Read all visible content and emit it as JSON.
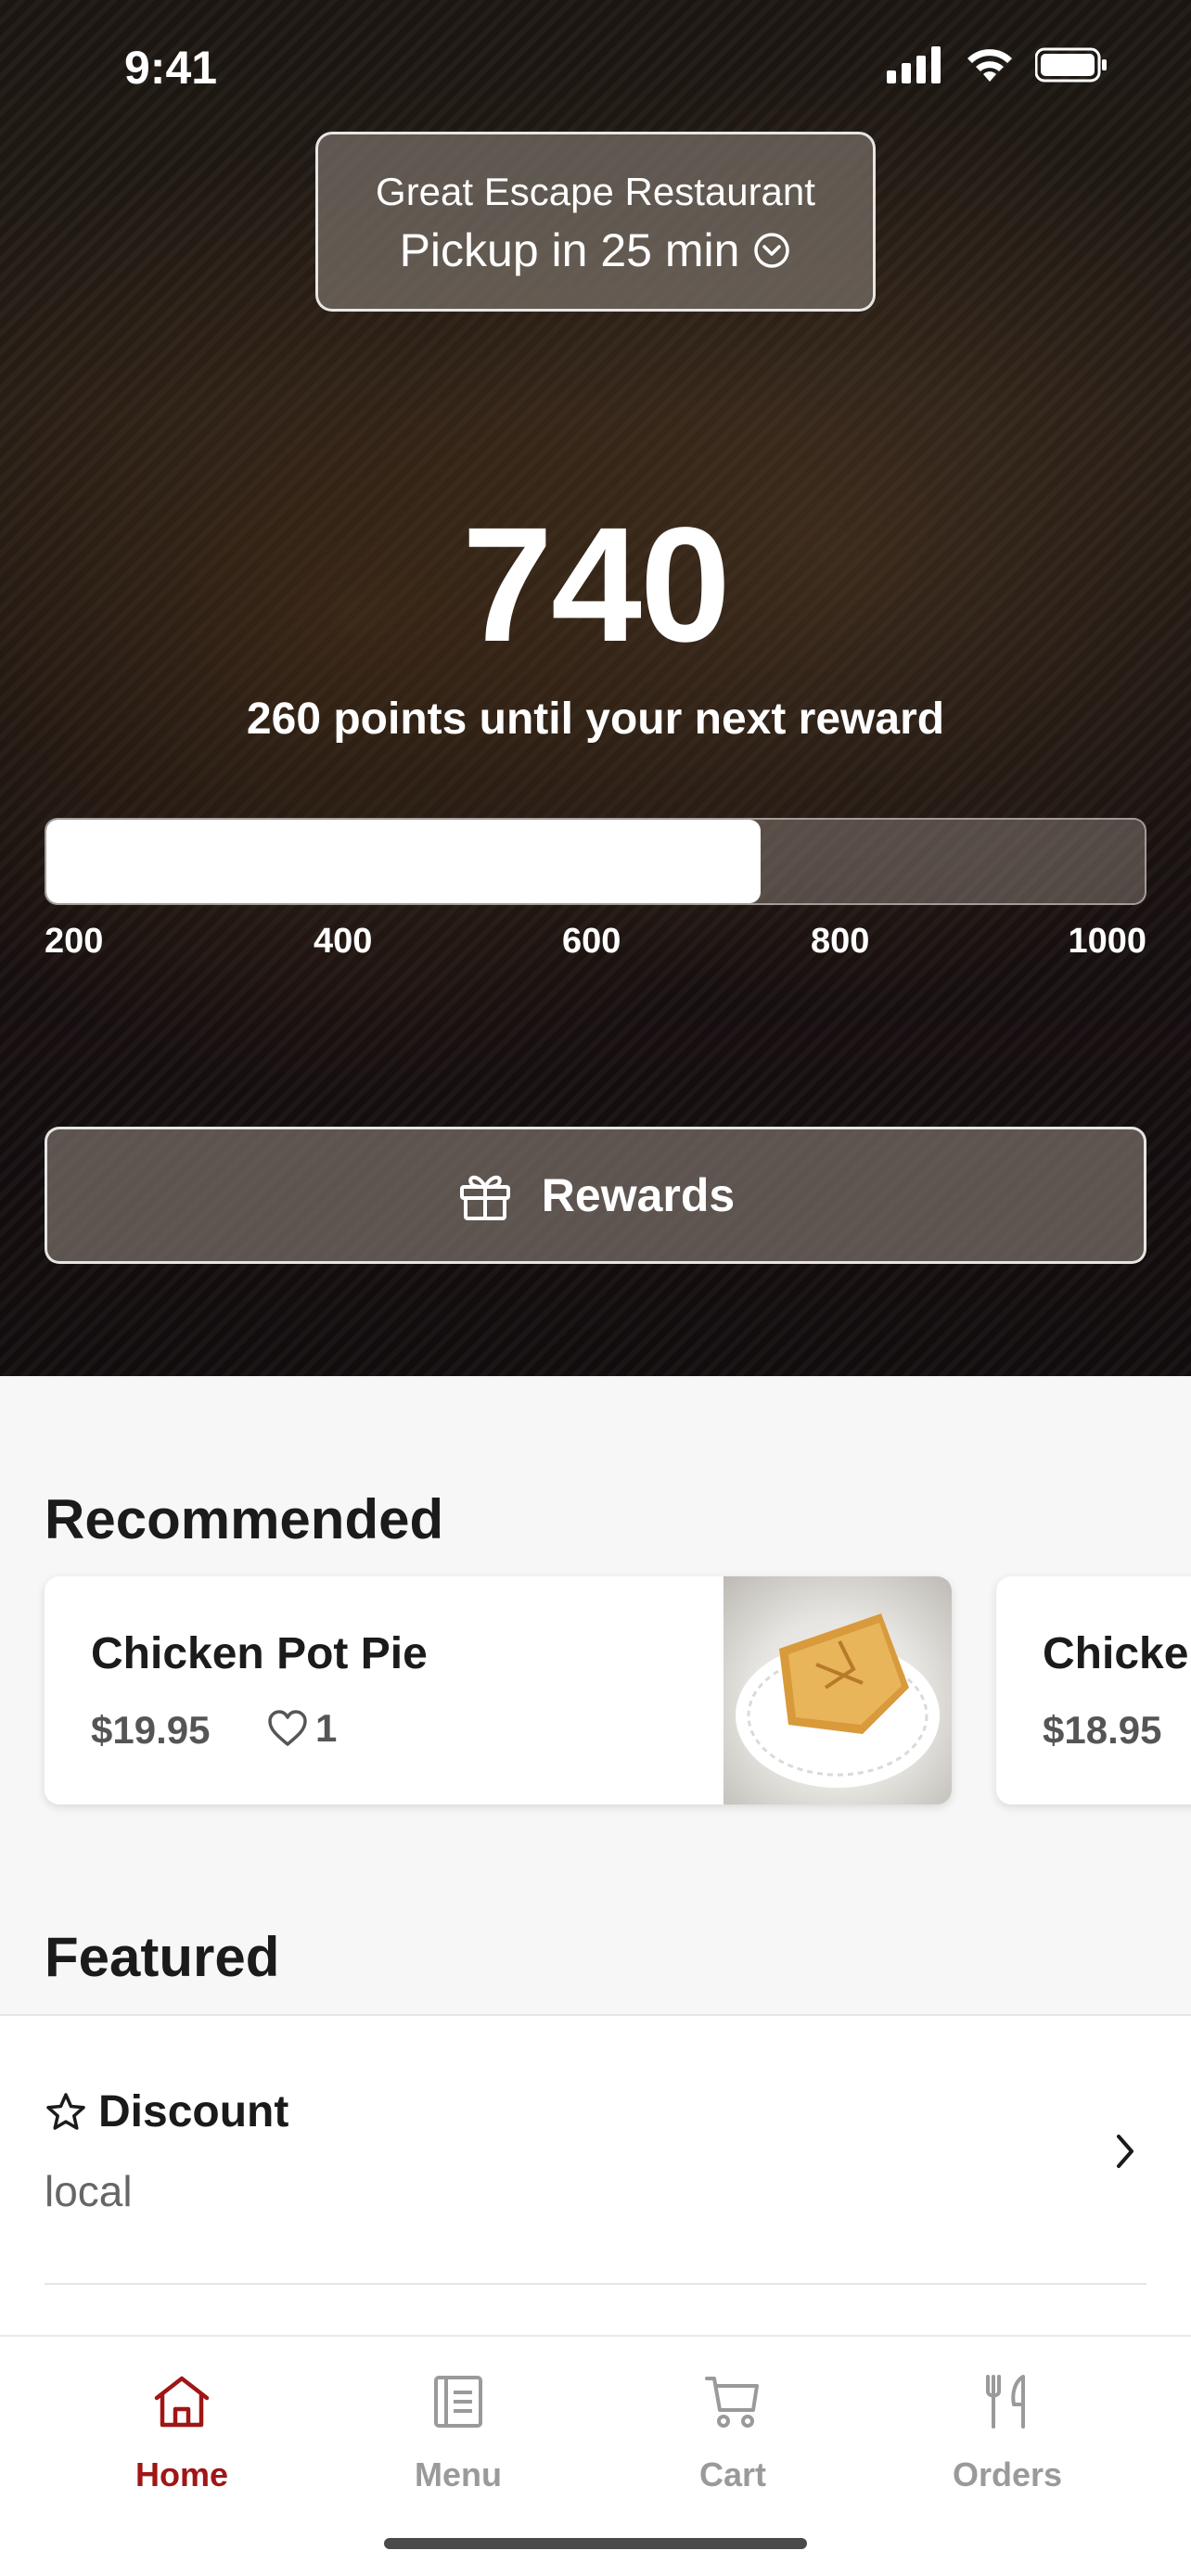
{
  "status_bar": {
    "time": "9:41"
  },
  "location": {
    "restaurant": "Great Escape Restaurant",
    "pickup": "Pickup in 25 min"
  },
  "rewards": {
    "points": "740",
    "until_text": "260 points until your next reward",
    "progress_fraction": 0.65,
    "ticks": [
      "200",
      "400",
      "600",
      "800",
      "1000"
    ],
    "button_label": "Rewards"
  },
  "recommended": {
    "title": "Recommended",
    "items": [
      {
        "name": "Chicken Pot Pie",
        "price": "$19.95",
        "likes": "1"
      },
      {
        "name": "Chicke",
        "price": "$18.95"
      }
    ]
  },
  "featured": {
    "title": "Featured",
    "items": [
      {
        "title": "Discount",
        "subtitle": "local"
      }
    ]
  },
  "tabs": [
    {
      "label": "Home",
      "icon": "home-icon",
      "active": true
    },
    {
      "label": "Menu",
      "icon": "menu-book-icon",
      "active": false
    },
    {
      "label": "Cart",
      "icon": "cart-icon",
      "active": false
    },
    {
      "label": "Orders",
      "icon": "fork-knife-icon",
      "active": false
    }
  ],
  "colors": {
    "accent": "#a01616",
    "inactive": "#9a9a9a"
  }
}
